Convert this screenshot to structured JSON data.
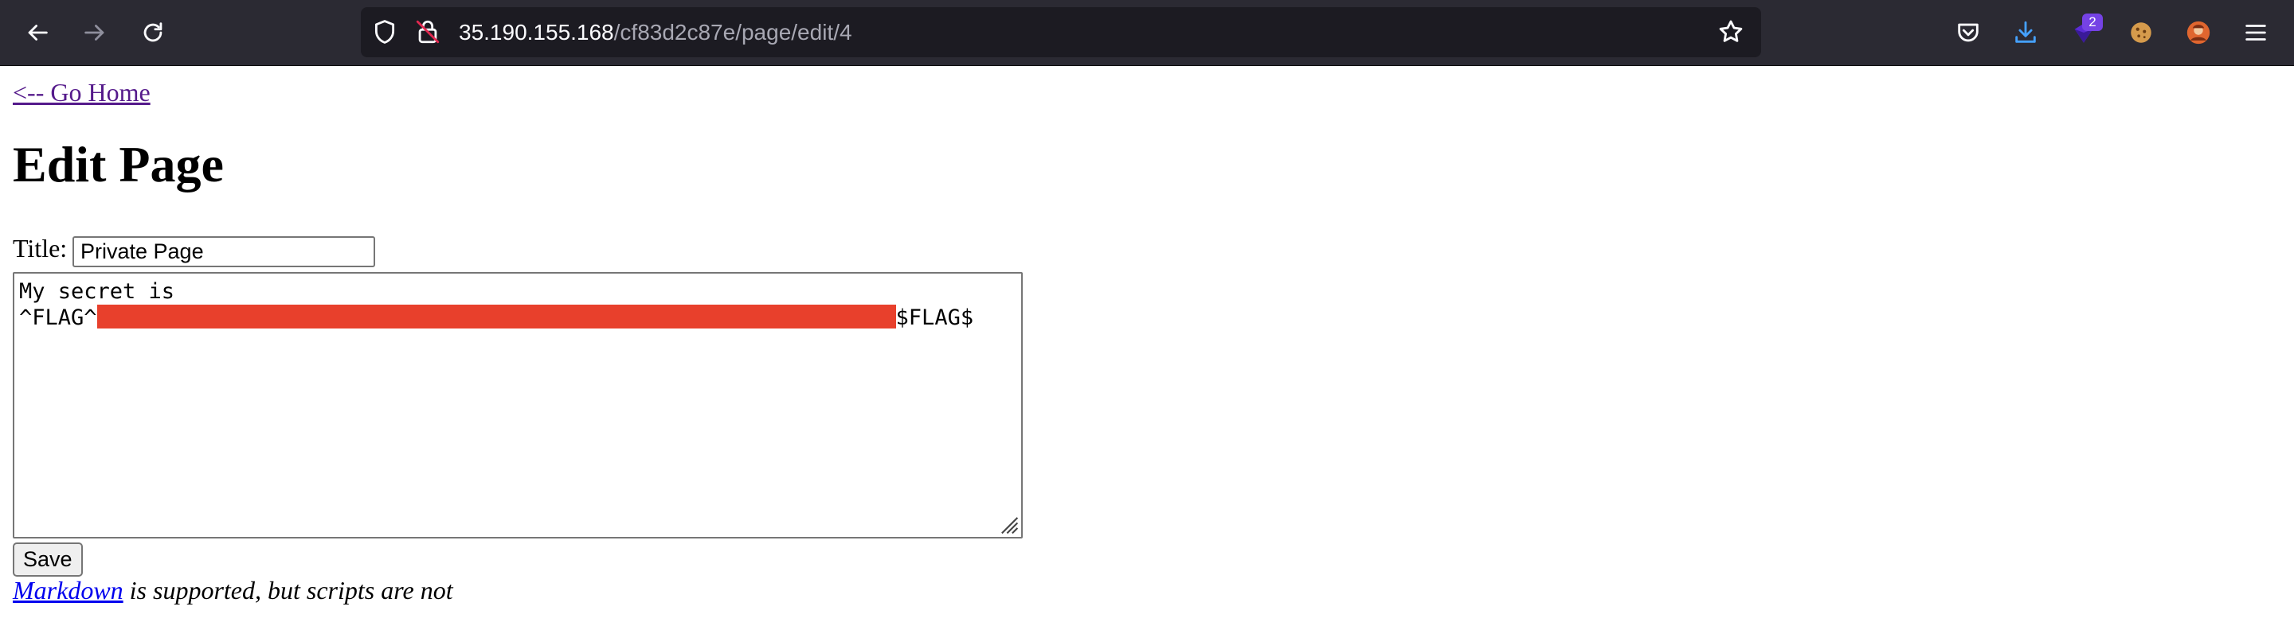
{
  "browser": {
    "url_host": "35.190.155.168",
    "url_path": "/cf83d2c87e/page/edit/4",
    "extension_badge_count": "2",
    "icons": {
      "back": "back-arrow-icon",
      "forward": "forward-arrow-icon",
      "reload": "reload-icon",
      "tracking": "shield-icon",
      "connection": "insecure-lock-icon",
      "bookmark": "star-icon",
      "pocket": "pocket-icon",
      "downloads": "download-icon",
      "extension": "extension-icon",
      "cookie": "cookie-icon",
      "profile": "avatar-icon",
      "menu": "hamburger-menu-icon"
    },
    "colors": {
      "toolbar": "#2b2a33",
      "urlbar": "#1c1b22",
      "download_accent": "#45a1ff",
      "badge": "#7542e5"
    }
  },
  "page": {
    "home_link": "<-- Go Home",
    "heading": "Edit Page",
    "title_label": "Title:",
    "title_value": "Private Page",
    "body_line1": "My secret is",
    "body_line2_prefix": "^FLAG^",
    "body_line2_suffix": "$FLAG$",
    "redaction_color": "#e8402c",
    "save_label": "Save",
    "note_link": "Markdown",
    "note_text": " is supported, but scripts are not"
  }
}
